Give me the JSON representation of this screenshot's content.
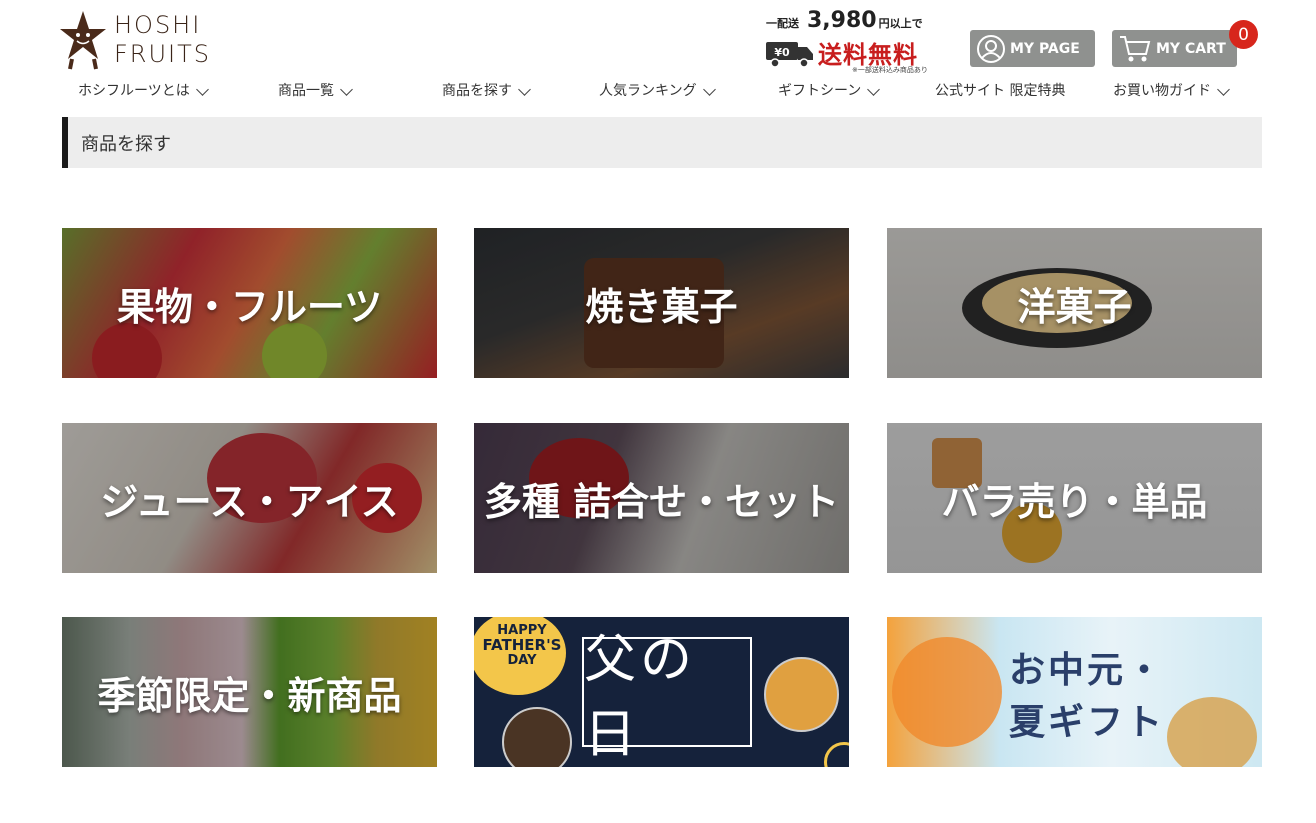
{
  "brand": {
    "line1": "HOSHI",
    "line2": "FRUITS"
  },
  "shipping": {
    "prefix": "一配送",
    "amount": "3,980",
    "suffix": "円以上で",
    "yen_badge": "¥0",
    "free": "送料無料",
    "note": "※一部送料込み商品あり"
  },
  "header_buttons": {
    "mypage": "MY PAGE",
    "cart": "MY CART",
    "cart_count": "0"
  },
  "nav": [
    {
      "label": "ホシフルーツとは",
      "chevron": true
    },
    {
      "label": "商品一覧",
      "chevron": true
    },
    {
      "label": "商品を探す",
      "chevron": true
    },
    {
      "label": "人気ランキング",
      "chevron": true
    },
    {
      "label": "ギフトシーン",
      "chevron": true
    },
    {
      "label": "公式サイト 限定特典",
      "chevron": false
    },
    {
      "label": "お買い物ガイド",
      "chevron": true
    }
  ],
  "breadcrumb": "商品を探す",
  "tiles": [
    {
      "label": "果物・フルーツ"
    },
    {
      "label": "焼き菓子"
    },
    {
      "label": "洋菓子"
    },
    {
      "label": "ジュース・アイス"
    },
    {
      "label": "多種 詰合せ・セット"
    },
    {
      "label": "バラ売り・単品"
    },
    {
      "label": "季節限定・新商品"
    },
    {
      "label": "父の日",
      "badge_lines": [
        "HAPPY",
        "FATHER'S",
        "DAY"
      ]
    },
    {
      "label_lines": [
        "お中元・",
        "夏ギフト"
      ]
    }
  ],
  "colors": {
    "accent_red": "#c81e1e",
    "button_gray": "#8f918f",
    "badge_red": "#d7261c",
    "father_navy": "#15223b",
    "father_yellow": "#f3c64a"
  }
}
